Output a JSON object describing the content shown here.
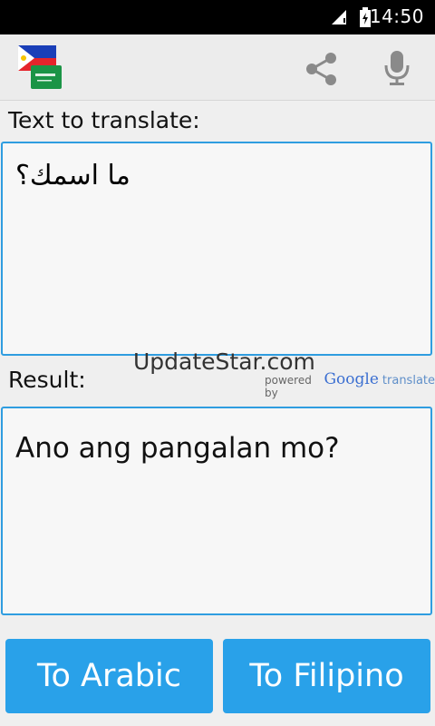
{
  "status": {
    "time": "14:50"
  },
  "labels": {
    "text_to_translate": "Text to translate:",
    "result": "Result:"
  },
  "source_text": "ما اسمك؟",
  "result_text": "Ano ang pangalan mo?",
  "watermark": "UpdateStar.com",
  "powered_by": {
    "prefix": "powered by",
    "brand": "Google",
    "suffix": "translate"
  },
  "buttons": {
    "to_arabic": "To Arabic",
    "to_filipino": "To Filipino"
  },
  "colors": {
    "accent": "#29a1e9",
    "border": "#2f9de0"
  },
  "icons": [
    "signal-icon",
    "battery-icon",
    "share-icon",
    "mic-icon",
    "flag-philippines-icon",
    "flag-saudi-icon"
  ]
}
